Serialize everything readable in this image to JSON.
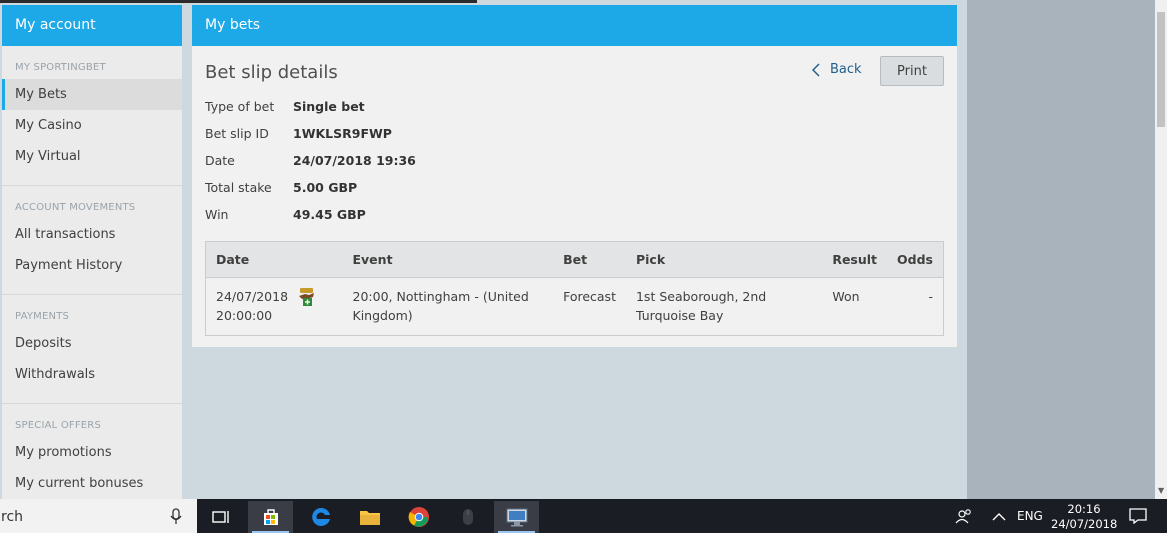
{
  "sidebar": {
    "title": "My account",
    "sections": [
      {
        "heading": "MY SPORTINGBET",
        "items": [
          "My Bets",
          "My Casino",
          "My Virtual"
        ]
      },
      {
        "heading": "ACCOUNT MOVEMENTS",
        "items": [
          "All transactions",
          "Payment History"
        ]
      },
      {
        "heading": "PAYMENTS",
        "items": [
          "Deposits",
          "Withdrawals"
        ]
      },
      {
        "heading": "SPECIAL OFFERS",
        "items": [
          "My promotions",
          "My current bonuses"
        ]
      }
    ],
    "active_item": "My Bets"
  },
  "main": {
    "header": "My bets",
    "title": "Bet slip details",
    "back_label": "Back",
    "print_label": "Print",
    "details": [
      {
        "label": "Type of bet",
        "value": "Single bet"
      },
      {
        "label": "Bet slip ID",
        "value": "1WKLSR9FWP"
      },
      {
        "label": "Date",
        "value": "24/07/2018 19:36"
      },
      {
        "label": "Total stake",
        "value": "5.00 GBP"
      },
      {
        "label": "Win",
        "value": "49.45 GBP"
      }
    ],
    "table": {
      "headers": [
        "Date",
        "",
        "Event",
        "Bet",
        "Pick",
        "Result",
        "Odds"
      ],
      "rows": [
        {
          "date_line1": "24/07/2018",
          "date_line2": "20:00:00",
          "event_line1": "20:00, Nottingham - (United",
          "event_line2": "Kingdom)",
          "bet": "Forecast",
          "pick_line1": "1st Seaborough, 2nd",
          "pick_line2": "Turquoise Bay",
          "result": "Won",
          "odds": "-"
        }
      ]
    }
  },
  "taskbar": {
    "search_text": "rch",
    "lang": "ENG",
    "time": "20:16",
    "date": "24/07/2018"
  },
  "colors": {
    "accent": "#1da8e8",
    "taskbar": "#1b1d24"
  }
}
